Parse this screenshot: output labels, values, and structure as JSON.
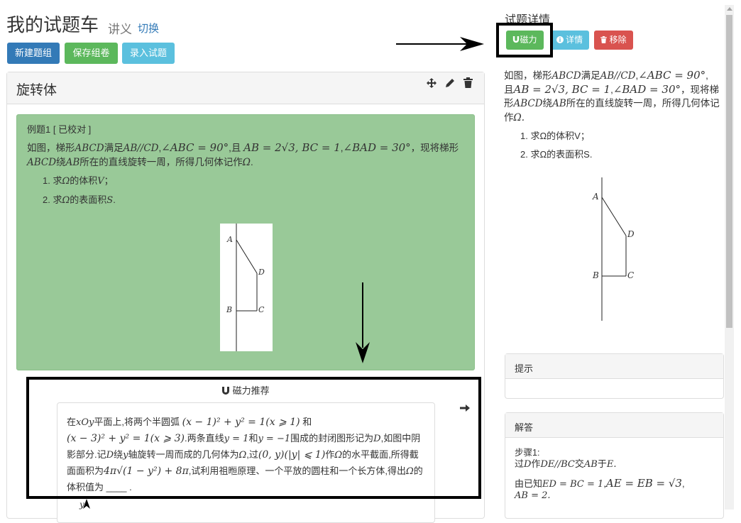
{
  "header": {
    "title": "我的试题车",
    "subtitle": "讲义",
    "switch_link": "切换"
  },
  "toolbar": {
    "new_group": "新建题组",
    "save_paper": "保存组卷",
    "enter_question": "录入试题"
  },
  "group": {
    "name": "旋转体"
  },
  "question": {
    "label": "例题1 [ 已校对 ]",
    "stem_a": "如图，梯形",
    "stem_b": "ABCD",
    "stem_c": "满足",
    "stem_d": "AB//CD",
    "stem_e": "∠ABC = 90°",
    "stem_f": "且",
    "stem_g": "AB = 2√3, BC = 1",
    "stem_h": "∠BAD = 30°",
    "stem_i": "，现将梯形",
    "stem_j": "绕",
    "stem_k": "AB",
    "stem_l": "所在的直线旋转一周，所得几何体记作",
    "stem_m": "Ω",
    "sub1_a": "求",
    "sub1_b": "Ω",
    "sub1_c": "的体积",
    "sub1_d": "V",
    "sub1_e": "；",
    "sub2_a": "求",
    "sub2_b": "Ω",
    "sub2_c": "的表面积",
    "sub2_d": "S",
    "sub2_e": "."
  },
  "figure": {
    "A": "A",
    "B": "B",
    "C": "C",
    "D": "D"
  },
  "recommend": {
    "title": "磁力推荐",
    "text1": "在",
    "text2": "xOy",
    "text3": "平面上,将两个半圆弧",
    "text4": "(x − 1)² + y² = 1(x ⩾ 1)",
    "text5": "和",
    "text6": "(x − 3)² + y² = 1(x ⩾ 3)",
    "text7": ".两条直线",
    "text8": "y = 1",
    "text9": "和",
    "text10": "y = −1",
    "text11": "围成的封闭图形记为",
    "text12": "D",
    "text13": ",如图中阴影部分.记",
    "text14": "D",
    "text15": "绕",
    "text16": "y",
    "text17": "轴旋转一周而成的几何体为",
    "text18": "Ω",
    "text19": ",过",
    "text20": "(0, y)(|y| ⩽ 1)",
    "text21": "作",
    "text22": "Ω",
    "text23": "的水平截面,所得截面面积为",
    "text24": "4π√(1 − y²) + 8π",
    "text25": ",试利用祖暅原理、一个平放的圆柱和一个长方体,得出",
    "text26": "Ω",
    "text27": "的体积值为 ____ .",
    "y_label": "y"
  },
  "detail": {
    "title": "试题详情",
    "btn_magnet": "磁力",
    "btn_detail": "详情",
    "btn_remove": "移除",
    "stem_a": "如图，梯形",
    "stem_b": "ABCD",
    "stem_c": "满足",
    "stem_d": "AB//CD",
    "stem_e": "∠ABC = 90°",
    "stem_f": "且",
    "stem_g": "AB = 2√3, BC = 1",
    "stem_h": "∠BAD = 30°",
    "stem_i": "，现将梯形",
    "stem_j": "绕",
    "stem_k": "AB",
    "stem_l": "所在的直线旋转一周，所得几何体记作",
    "stem_m": "Ω.",
    "sub1": "求Ω的体积V；",
    "sub2": "求Ω的表面积S."
  },
  "hint": {
    "title": "提示"
  },
  "answer": {
    "title": "解答",
    "step": "步骤1:",
    "line1a": "过",
    "line1b": "D",
    "line1c": "作",
    "line1d": "DE//BC",
    "line1e": "交",
    "line1f": "AB",
    "line1g": "于",
    "line1h": "E.",
    "line2a": "由已知",
    "line2b": "ED = BC = 1",
    "line2c": "AE = EB = √3",
    "line3": "AB = 2."
  },
  "colors": {
    "question_bg": "#99c998",
    "primary": "#337ab7",
    "success": "#5cb85c",
    "info": "#5bc0de",
    "danger": "#d9534f"
  }
}
